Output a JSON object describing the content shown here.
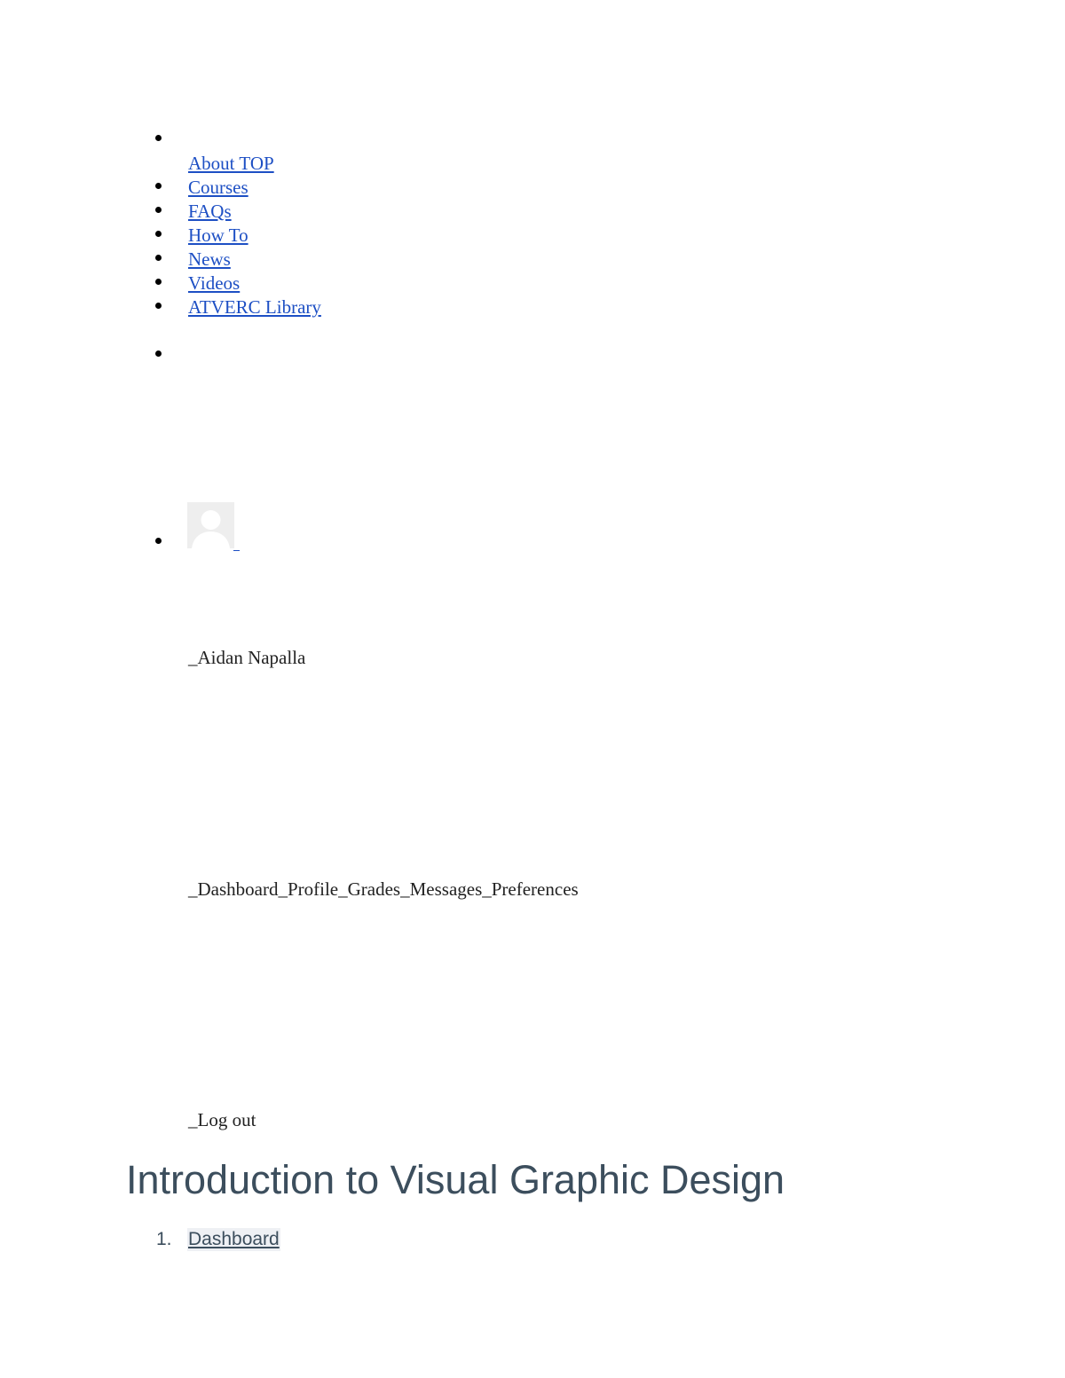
{
  "nav": {
    "items": [
      {
        "label": ""
      },
      {
        "label": "About TOP"
      },
      {
        "label": "Courses"
      },
      {
        "label": "FAQs"
      },
      {
        "label": "How To"
      },
      {
        "label": "News"
      },
      {
        "label": "Videos"
      },
      {
        "label": "ATVERC Library"
      }
    ]
  },
  "user_menu": {
    "user_name": "_Aidan Napalla",
    "links_line": "_Dashboard_Profile_Grades_Messages_Preferences",
    "logout": "_Log out"
  },
  "page": {
    "title": "Introduction to Visual Graphic Design"
  },
  "breadcrumb": {
    "items": [
      {
        "number": "1.",
        "label": "Dashboard"
      }
    ]
  },
  "colors": {
    "link": "#1d4fc4",
    "title": "#3c4e5d",
    "avatar_bg": "#eeeeee"
  }
}
